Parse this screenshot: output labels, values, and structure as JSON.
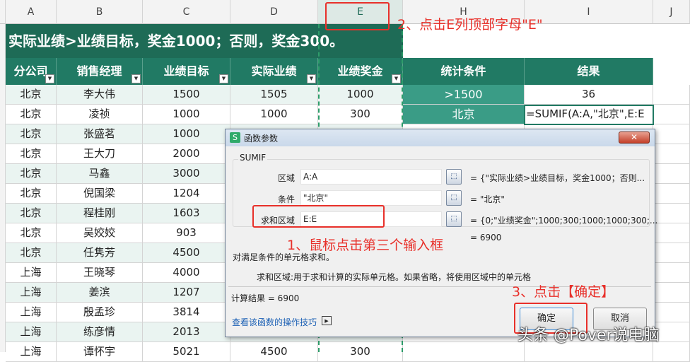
{
  "columns": [
    "A",
    "B",
    "C",
    "D",
    "E",
    "H",
    "I",
    "J"
  ],
  "title_banner": "实际业绩>业绩目标，奖金1000；否则，奖金300。",
  "headers": [
    "分公司",
    "销售经理",
    "业绩目标",
    "实际业绩",
    "业绩奖金"
  ],
  "stats": {
    "headers": [
      "统计条件",
      "结果"
    ],
    "rows": [
      [
        ">1500",
        "36"
      ],
      [
        "北京",
        "=SUMIF(A:A,\"北京\",E:E"
      ]
    ]
  },
  "rows": [
    [
      "北京",
      "李大伟",
      "1500",
      "1505",
      "1000"
    ],
    [
      "北京",
      "凌祯",
      "1000",
      "1000",
      "300"
    ],
    [
      "北京",
      "张盛茗",
      "1000",
      "",
      ""
    ],
    [
      "北京",
      "王大刀",
      "2000",
      "",
      ""
    ],
    [
      "北京",
      "马鑫",
      "3000",
      "",
      ""
    ],
    [
      "北京",
      "倪国梁",
      "1204",
      "",
      ""
    ],
    [
      "北京",
      "程桂刚",
      "1603",
      "",
      ""
    ],
    [
      "北京",
      "吴姣姣",
      "903",
      "",
      ""
    ],
    [
      "北京",
      "任隽芳",
      "4500",
      "",
      ""
    ],
    [
      "上海",
      "王晓琴",
      "4000",
      "",
      ""
    ],
    [
      "上海",
      "姜滨",
      "1207",
      "",
      ""
    ],
    [
      "上海",
      "殷孟珍",
      "3814",
      "",
      ""
    ],
    [
      "上海",
      "练彦情",
      "2013",
      "",
      ""
    ],
    [
      "上海",
      "谭怀宇",
      "5021",
      "4500",
      "300"
    ]
  ],
  "dialog": {
    "title": "函数参数",
    "app_icon": "S",
    "function_name": "SUMIF",
    "args": [
      {
        "label": "区域",
        "value": "A:A",
        "result": "= {\"实际业绩>业绩目标，奖金1000；否则..."
      },
      {
        "label": "条件",
        "value": "\"北京\"",
        "result": "= \"北京\""
      },
      {
        "label": "求和区域",
        "value": "E:E",
        "result": "= {0;\"业绩奖金\";1000;300;1000;1000;300;..."
      }
    ],
    "overall_result": "= 6900",
    "description": "对满足条件的单元格求和。",
    "arg_help_label": "求和区域:",
    "arg_help": "用于求和计算的实际单元格。如果省略，将使用区域中的单元格",
    "calc_result": "计算结果 = 6900",
    "help_link": "查看该函数的操作技巧",
    "ok": "确定",
    "cancel": "取消"
  },
  "annotations": {
    "step1": "1、鼠标点击第三个输入框",
    "step2": "2、点击E列顶部字母\"E\"",
    "step3": "3、点击【确定】"
  },
  "watermark": "头条 @Pover说电脑"
}
